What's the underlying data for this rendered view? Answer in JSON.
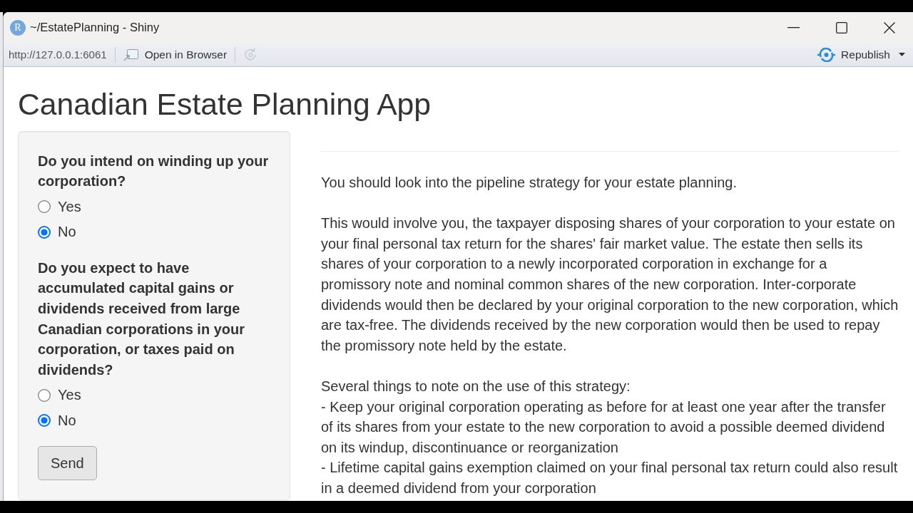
{
  "window": {
    "logo": "R",
    "title": "~/EstatePlanning - Shiny"
  },
  "toolbar": {
    "url": "http://127.0.0.1:6061",
    "open_in_browser": "Open in Browser",
    "refresh": {
      "disabled": true
    },
    "publish": "Republish"
  },
  "app": {
    "title": "Canadian Estate Planning App",
    "questions": [
      {
        "label": "Do you intend on winding up your corporation?",
        "options": [
          {
            "label": "Yes",
            "selected": false
          },
          {
            "label": "No",
            "selected": true
          }
        ]
      },
      {
        "label": "Do you expect to have accumulated capital gains or dividends received from large Canadian corporations in your corporation, or taxes paid on dividends?",
        "options": [
          {
            "label": "Yes",
            "selected": false
          },
          {
            "label": "No",
            "selected": true
          }
        ]
      }
    ],
    "submit": "Send",
    "output": {
      "paragraphs": [
        "You should look into the pipeline strategy for your estate planning.",
        "This would involve you, the taxpayer disposing shares of your corporation to your estate on your final personal tax return for the shares' fair market value. The estate then sells its shares of your corporation to a newly incorporated corporation in exchange for a promissory note and nominal common shares of the new corporation. Inter-corporate dividends would then be declared by your original corporation to the new corporation, which are tax-free. The dividends received by the new corporation would then be used to repay the promissory note held by the estate."
      ],
      "notes_heading": "Several things to note on the use of this strategy:",
      "notes": [
        "- Keep your original corporation operating as before for at least one year after the transfer of its shares from your estate to the new corporation to avoid a possible deemed dividend on its windup, discontinuance or reorganization",
        "- Lifetime capital gains exemption claimed on your final personal tax return could also result in a deemed dividend from your corporation"
      ]
    }
  }
}
